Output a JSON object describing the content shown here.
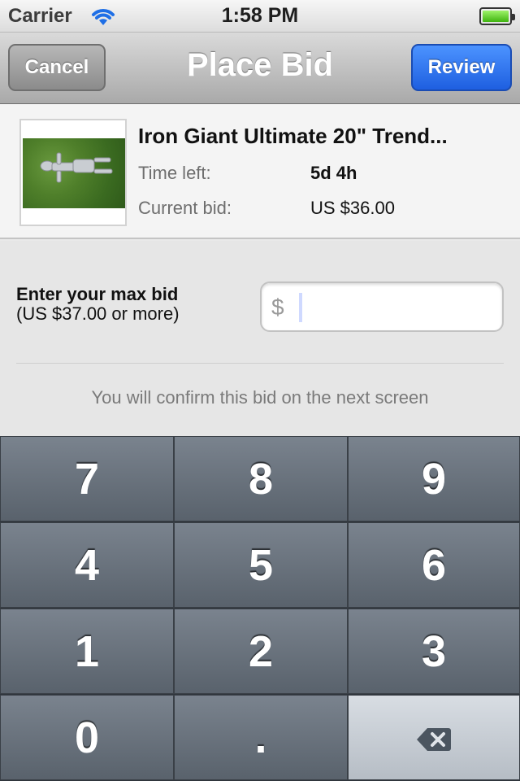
{
  "status_bar": {
    "carrier": "Carrier",
    "time": "1:58 PM",
    "battery_level": 1.0,
    "icons": [
      "wifi-icon",
      "battery-icon"
    ]
  },
  "nav": {
    "title": "Place Bid",
    "cancel_label": "Cancel",
    "review_label": "Review"
  },
  "item": {
    "title": "Iron Giant Ultimate 20\" Trend...",
    "time_left_label": "Time left:",
    "time_left_value": "5d 4h",
    "current_bid_label": "Current bid:",
    "current_bid_value": "US $36.00"
  },
  "bid": {
    "label_main": "Enter your max bid",
    "label_sub": "(US $37.00 or more)",
    "currency_symbol": "$",
    "input_value": "",
    "confirm_note": "You will confirm this bid on the next screen"
  },
  "keypad": {
    "keys": [
      "7",
      "8",
      "9",
      "4",
      "5",
      "6",
      "1",
      "2",
      "3",
      "0",
      ".",
      "backspace-icon"
    ]
  },
  "colors": {
    "review_blue": "#2b6ff0",
    "keypad_dark": "#5f6872",
    "battery_green": "#4bc418"
  }
}
